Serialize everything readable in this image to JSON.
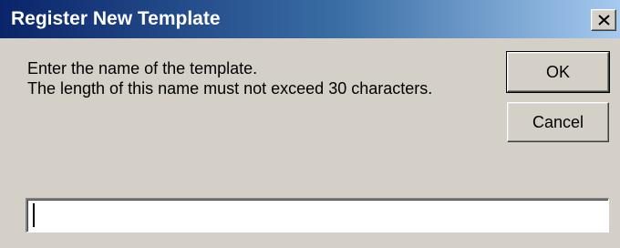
{
  "dialog": {
    "title": "Register New Template",
    "message_line1": "Enter the name of the template.",
    "message_line2": "The length of this name must not exceed 30 characters.",
    "ok_label": "OK",
    "cancel_label": "Cancel",
    "name_value": "",
    "close_icon": "close-icon"
  },
  "colors": {
    "dialog_bg": "#d4d0c8",
    "titlebar_start": "#0a246a",
    "titlebar_end": "#a6caf0",
    "title_text": "#ffffff"
  }
}
